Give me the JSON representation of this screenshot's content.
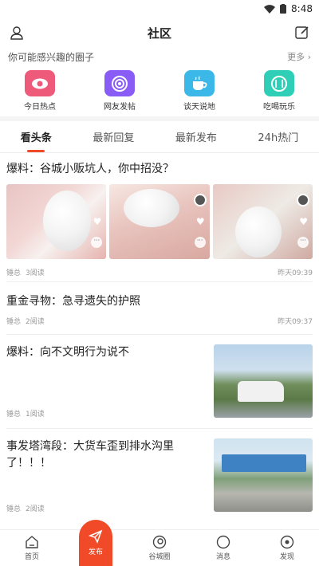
{
  "status": {
    "time": "8:48"
  },
  "header": {
    "title": "社区"
  },
  "circles": {
    "title": "你可能感兴趣的圈子",
    "more": "更多 ›",
    "items": [
      {
        "label": "今日热点",
        "color": "#ee5a79",
        "icon": "eye-icon"
      },
      {
        "label": "网友发帖",
        "color": "#8a5cf6",
        "icon": "broadcast-icon"
      },
      {
        "label": "谈天说地",
        "color": "#3bb8e8",
        "icon": "coffee-icon"
      },
      {
        "label": "吃喝玩乐",
        "color": "#2ecfb6",
        "icon": "utensils-icon"
      }
    ]
  },
  "tabs": [
    {
      "label": "看头条",
      "active": true
    },
    {
      "label": "最新回复",
      "active": false
    },
    {
      "label": "最新发布",
      "active": false
    },
    {
      "label": "24h热门",
      "active": false
    }
  ],
  "posts": [
    {
      "title": "爆料：谷城小贩坑人，你中招没？",
      "author": "锤总",
      "reads": "3阅读",
      "time": "昨天09:39"
    },
    {
      "title": "重金寻物：急寻遗失的护照",
      "author": "锤总",
      "reads": "2阅读",
      "time": "昨天09:37"
    },
    {
      "title": "爆料：向不文明行为说不",
      "author": "锤总",
      "reads": "1阅读",
      "time": ""
    },
    {
      "title": "事发塔湾段：大货车歪到排水沟里了！！！",
      "author": "锤总",
      "reads": "2阅读",
      "time": ""
    }
  ],
  "nav": {
    "home": "首页",
    "publish": "发布",
    "circle": "谷城圈",
    "messages": "消息",
    "discover": "发现"
  },
  "colors": {
    "accent": "#f04a28"
  }
}
